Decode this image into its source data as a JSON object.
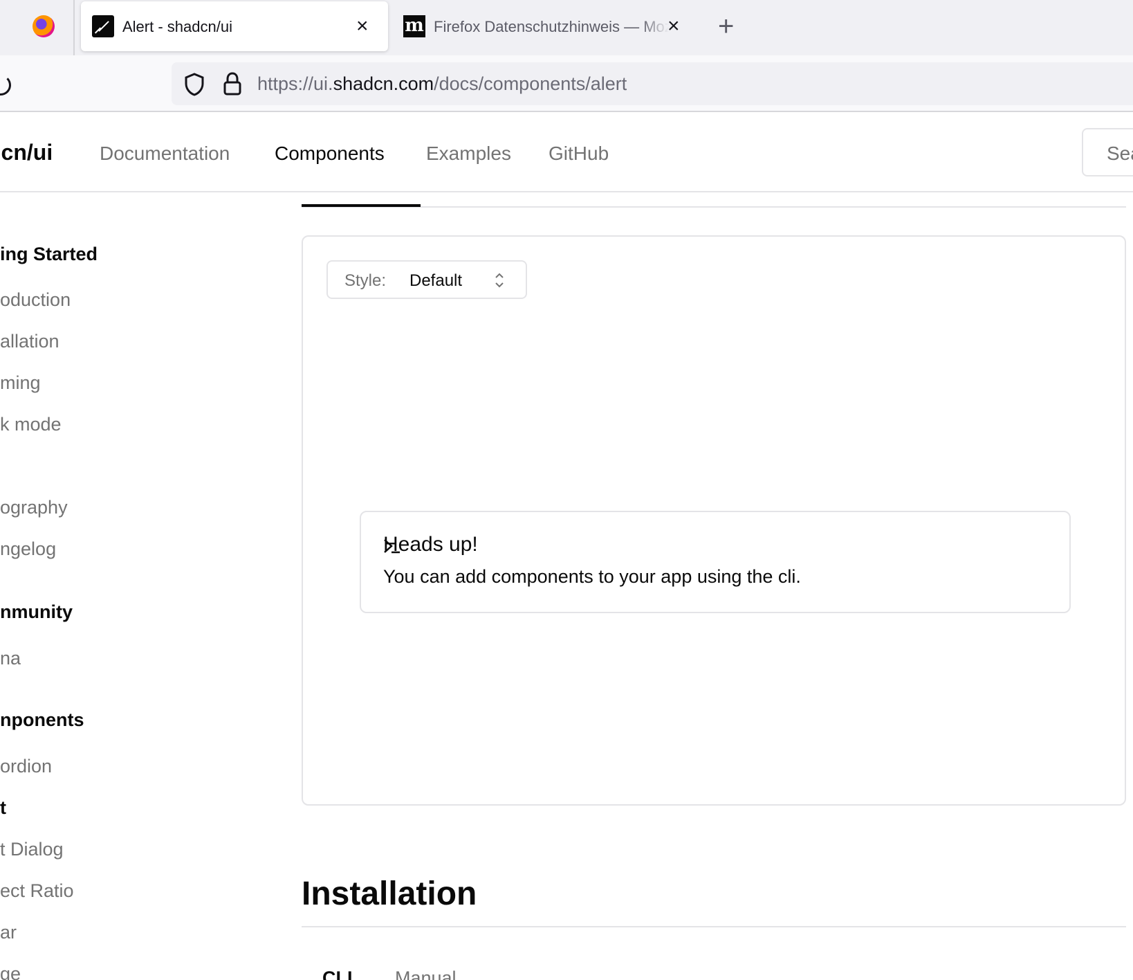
{
  "browser": {
    "tabs": [
      {
        "title": "Alert - shadcn/ui",
        "active": true
      },
      {
        "title": "Firefox Datenschutzhinweis — Mozilla",
        "active": false
      }
    ],
    "close_glyph": "×",
    "new_tab_glyph": "+",
    "url": {
      "scheme": "https://ui.",
      "host": "shadcn.com",
      "path": "/docs/components/alert"
    }
  },
  "header": {
    "brand": "dcn/ui",
    "nav": [
      "Documentation",
      "Components",
      "Examples",
      "GitHub"
    ],
    "active_nav": "Components",
    "search_placeholder": "Sea"
  },
  "sidebar": {
    "sections": [
      {
        "heading": "ing Started",
        "items": [
          "oduction",
          "allation",
          "ming",
          "k mode",
          "ography",
          "ngelog"
        ]
      },
      {
        "heading": "nmunity",
        "items": [
          "na"
        ]
      },
      {
        "heading": "nponents",
        "items": [
          "ordion",
          "t",
          "t Dialog",
          "ect Ratio",
          "ar",
          "ge"
        ]
      }
    ]
  },
  "preview": {
    "style_label": "Style:",
    "style_value": "Default",
    "alert_title": "Heads up!",
    "alert_description": "You can add components to your app using the cli."
  },
  "installation": {
    "heading": "Installation",
    "tabs": [
      "CLI",
      "Manual"
    ]
  },
  "colors": {
    "accent": "#0a0a0a",
    "muted_text": "#737373",
    "border": "#e4e4e7"
  }
}
